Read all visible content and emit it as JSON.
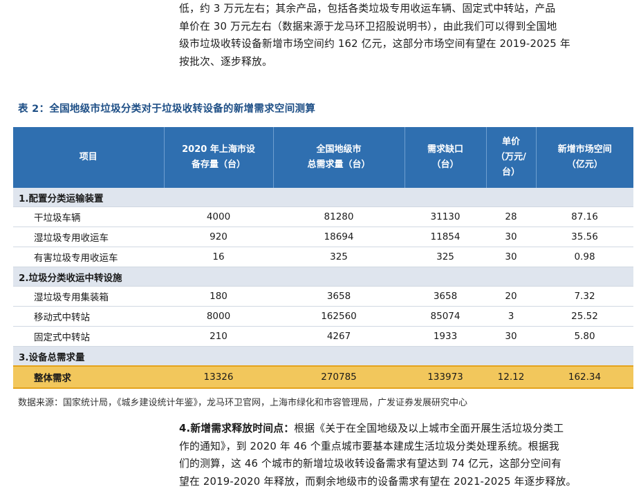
{
  "intro_lines": [
    "低，约 3 万元左右；其余产品，包括各类垃圾专用收运车辆、固定式中转站，产品",
    "单价在 30 万元左右（数据来源于龙马环卫招股说明书），由此我们可以得到全国地",
    "级市垃圾收转设备新增市场空间约 162 亿元，这部分市场空间有望在 2019-2025 年",
    "按批次、逐步释放。"
  ],
  "table_title": "表 2：全国地级市垃圾分类对于垃圾收转设备的新增需求空间测算",
  "headers": {
    "item": "项目",
    "col1_l1": "2020 年上海市设",
    "col1_l2": "备存量（台）",
    "col2_l1": "全国地级市",
    "col2_l2": "总需求量（台）",
    "col3_l1": "需求缺口",
    "col3_l2": "（台）",
    "col4_l1": "单价",
    "col4_l2": "（万元/",
    "col4_l3": "台）",
    "col5_l1": "新增市场空间",
    "col5_l2": "（亿元）"
  },
  "sections": [
    {
      "title": "1.配置分类运输装置",
      "rows": [
        {
          "name": "干垃圾车辆",
          "stock": "4000",
          "demand": "81280",
          "gap": "31130",
          "price": "28",
          "market": "87.16"
        },
        {
          "name": "湿垃圾专用收运车",
          "stock": "920",
          "demand": "18694",
          "gap": "11854",
          "price": "30",
          "market": "35.56"
        },
        {
          "name": "有害垃圾专用收运车",
          "stock": "16",
          "demand": "325",
          "gap": "325",
          "price": "30",
          "market": "0.98"
        }
      ]
    },
    {
      "title": "2.垃圾分类收运中转设施",
      "rows": [
        {
          "name": "湿垃圾专用集装箱",
          "stock": "180",
          "demand": "3658",
          "gap": "3658",
          "price": "20",
          "market": "7.32"
        },
        {
          "name": "移动式中转站",
          "stock": "8000",
          "demand": "162560",
          "gap": "85074",
          "price": "3",
          "market": "25.52"
        },
        {
          "name": "固定式中转站",
          "stock": "210",
          "demand": "4267",
          "gap": "1933",
          "price": "30",
          "market": "5.80"
        }
      ]
    },
    {
      "title": "3.设备总需求量",
      "rows": []
    }
  ],
  "total": {
    "name": "整体需求",
    "stock": "13326",
    "demand": "270785",
    "gap": "133973",
    "price": "12.12",
    "market": "162.34"
  },
  "source": "数据来源：国家统计局，《城乡建设统计年鉴》，龙马环卫官网，上海市绿化和市容管理局，广发证券发展研究中心",
  "outro": {
    "lead": "4.新增需求释放时间点：",
    "lines": [
      "根据《关于在全国地级及以上城市全面开展生活垃圾分类工",
      "作的通知》，到 2020 年 46 个重点城市要基本建成生活垃圾分类处理系统。根据我",
      "们的测算，这 46 个城市的新增垃圾收转设备需求有望达到 74 亿元，这部分空间有",
      "望在 2019-2020 年释放，而剩余地级市的设备需求有望在 2021-2025 年逐步释放。"
    ]
  }
}
